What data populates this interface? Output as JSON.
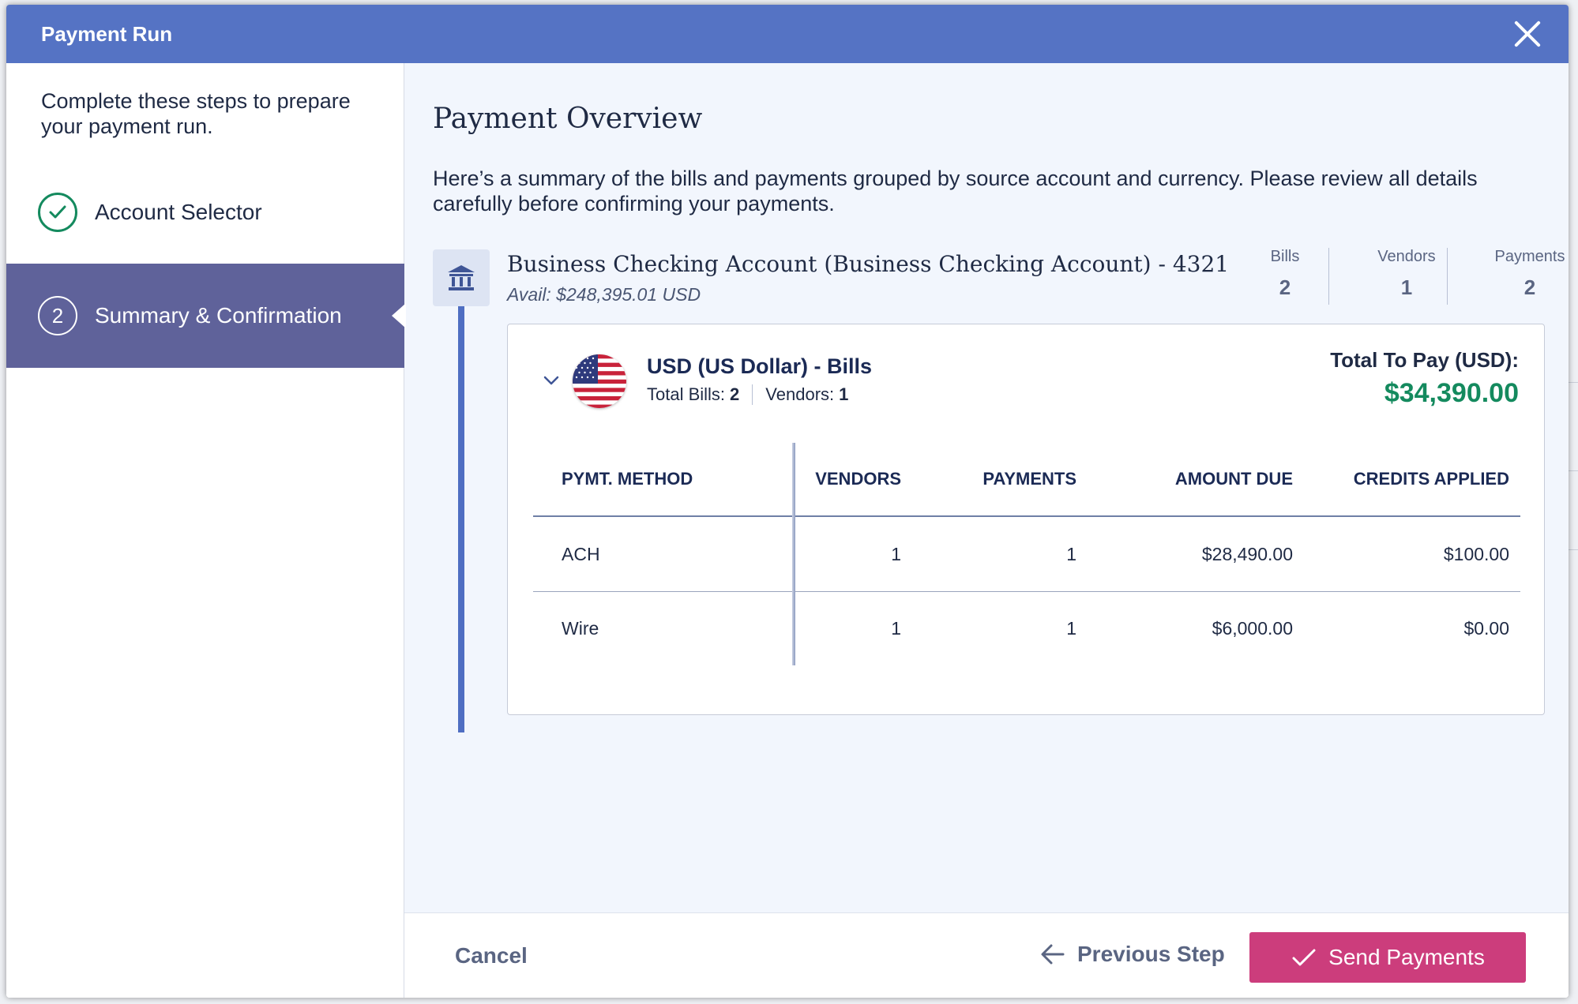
{
  "window": {
    "title": "Payment Run"
  },
  "sidebar": {
    "intro": "Complete these steps to prepare your payment run.",
    "steps": [
      {
        "label": "Account Selector",
        "status": "complete"
      },
      {
        "number": "2",
        "label": "Summary & Confirmation",
        "status": "active"
      }
    ]
  },
  "overview": {
    "heading": "Payment Overview",
    "description": "Here’s a summary of the bills and payments grouped by source account and currency. Please review all details carefully before confirming your payments."
  },
  "account": {
    "name": "Business Checking Account (Business Checking Account) - 4321",
    "available": "Avail: $248,395.01 USD",
    "stats": [
      {
        "label": "Bills",
        "value": "2"
      },
      {
        "label": "Vendors",
        "value": "1"
      },
      {
        "label": "Payments",
        "value": "2"
      }
    ]
  },
  "currency_group": {
    "title": "USD (US Dollar) - Bills",
    "total_bills_label": "Total Bills:",
    "total_bills": "2",
    "vendors_label": "Vendors:",
    "vendors": "1",
    "total_to_pay_label": "Total To Pay (USD):",
    "total_to_pay": "$34,390.00",
    "table": {
      "headers": [
        "PYMT. METHOD",
        "VENDORS",
        "PAYMENTS",
        "AMOUNT DUE",
        "CREDITS APPLIED"
      ],
      "rows": [
        [
          "ACH",
          "1",
          "1",
          "$28,490.00",
          "$100.00"
        ],
        [
          "Wire",
          "1",
          "1",
          "$6,000.00",
          "$0.00"
        ]
      ]
    }
  },
  "footer": {
    "cancel": "Cancel",
    "previous": "Previous Step",
    "send": "Send Payments"
  },
  "colors": {
    "header": "#5573c4",
    "active_step": "#5f629a",
    "success": "#148a5e",
    "send_button": "#cc3d7c"
  },
  "icons": {
    "close": "close-icon",
    "step_complete": "check-circle-icon",
    "bank": "bank-icon",
    "chevron": "chevron-down-icon",
    "flag": "us-flag-icon",
    "back": "arrow-left-icon",
    "send": "check-icon"
  }
}
